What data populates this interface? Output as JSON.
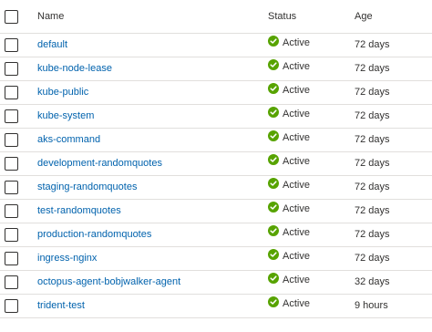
{
  "columns": {
    "name": "Name",
    "status": "Status",
    "age": "Age"
  },
  "rows": [
    {
      "name": "default",
      "status": "Active",
      "age": "72 days"
    },
    {
      "name": "kube-node-lease",
      "status": "Active",
      "age": "72 days"
    },
    {
      "name": "kube-public",
      "status": "Active",
      "age": "72 days"
    },
    {
      "name": "kube-system",
      "status": "Active",
      "age": "72 days"
    },
    {
      "name": "aks-command",
      "status": "Active",
      "age": "72 days"
    },
    {
      "name": "development-randomquotes",
      "status": "Active",
      "age": "72 days"
    },
    {
      "name": "staging-randomquotes",
      "status": "Active",
      "age": "72 days"
    },
    {
      "name": "test-randomquotes",
      "status": "Active",
      "age": "72 days"
    },
    {
      "name": "production-randomquotes",
      "status": "Active",
      "age": "72 days"
    },
    {
      "name": "ingress-nginx",
      "status": "Active",
      "age": "72 days"
    },
    {
      "name": "octopus-agent-bobjwalker-agent",
      "status": "Active",
      "age": "32 days"
    },
    {
      "name": "trident-test",
      "status": "Active",
      "age": "9 hours"
    }
  ],
  "colors": {
    "link": "#0062ad",
    "status_ok": "#57a300",
    "border": "#e1dfdd"
  },
  "icons": {
    "status": "check-circle-icon",
    "row_select": "checkbox"
  }
}
